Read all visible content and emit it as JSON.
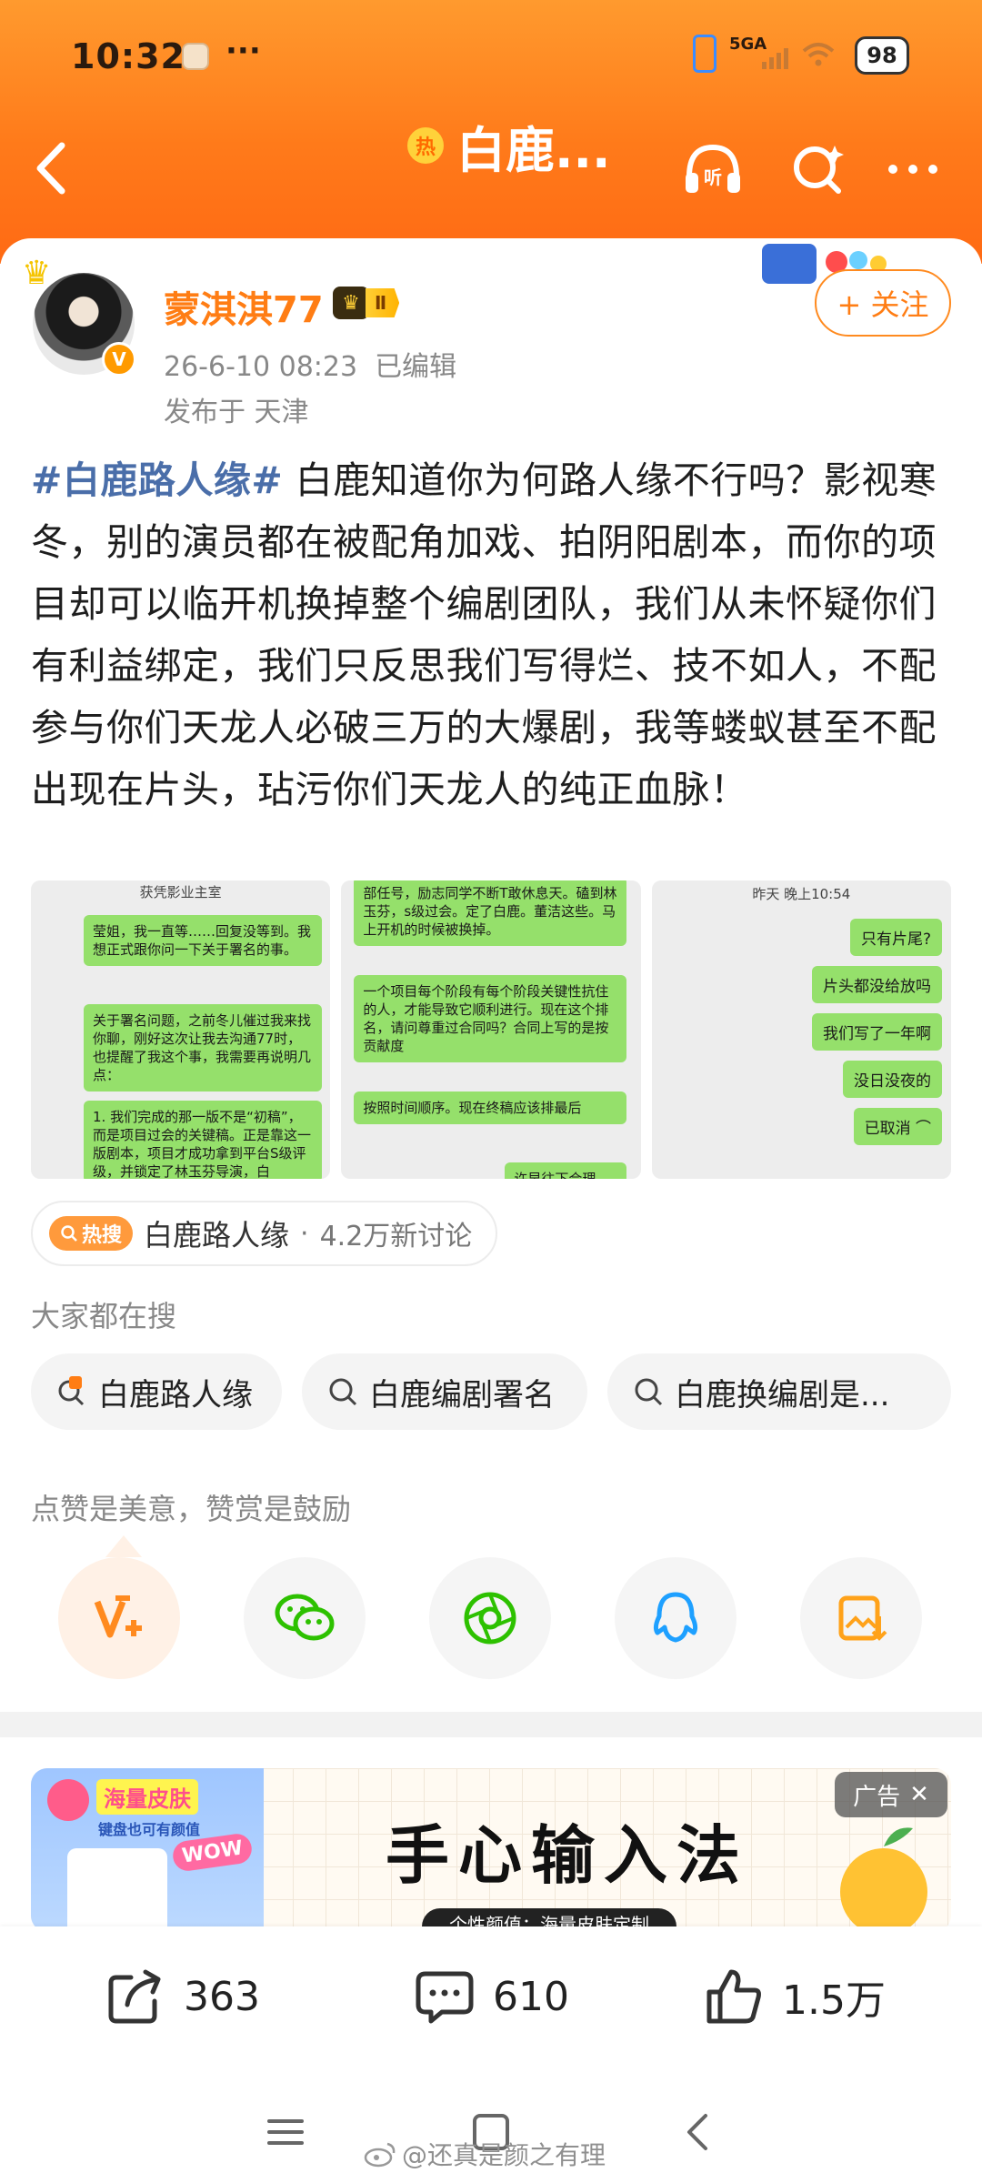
{
  "status_bar": {
    "time": "10:32",
    "dots": "···",
    "network": "5GA",
    "battery": "98"
  },
  "nav": {
    "title": "白鹿...",
    "hot_badge": "热"
  },
  "post": {
    "author": "蒙淇淇77",
    "level": "Ⅱ",
    "time": "26-6-10 08:23",
    "edited": "已编辑",
    "location": "发布于 天津",
    "follow_label": "+ 关注",
    "hashtag": "#白鹿路人缘#",
    "text": " 白鹿知道你为何路人缘不行吗？影视寒冬，别的演员都在被配角加戏、拍阴阳剧本，而你的项目却可以临开机换掉整个编剧团队，我们从未怀疑你们有利益绑定，我们只反思我们写得烂、技不如人，不配参与你们天龙人必破三万的大爆剧，我等蝼蚁甚至不配出现在片头，玷污你们天龙人的纯正血脉！"
  },
  "screenshots": {
    "shot1": {
      "header": "获凭影业主室",
      "bubbles": [
        "莹姐，我一直等……回复没等到。我想正式跟你问一下关于署名的事。",
        "关于署名问题，之前冬儿催过我来找你聊，刚好这次让我去沟通77时，也提醒了我这个事，我需要再说明几点：",
        "1. 我们完成的那一版不是“初稿”，而是项目过会的关键稿。正是靠这一版剧本，项目才成功拿到平台S级评级，并锁定了林玉芬导演，白"
      ]
    },
    "shot2": {
      "bubbles": [
        "部任号，励志同学不断T敢休息天。磕到林玉芬，s级过会。定了白鹿。董洁这些。马上开机的时候被换掉。",
        "一个项目每个阶段有每个阶段关键性抗住的人，才能导致它顺利进行。现在这个排名，请问尊重过合同吗？合同上写的是按贡献度",
        "按照时间顺序。现在终稿应该排最后",
        "许早往下合理"
      ]
    },
    "shot3": {
      "header": "昨天 晚上10:54",
      "bubbles": [
        "只有片尾?",
        "片头都没给放吗",
        "我们写了一年啊",
        "没日没夜的",
        "已取消 ⌒"
      ]
    }
  },
  "topic": {
    "hot_search_label": "热搜",
    "name": "白鹿路人缘",
    "separator": "·",
    "count": "4.2万新讨论"
  },
  "search_section": {
    "title": "大家都在搜",
    "chips": [
      "白鹿路人缘",
      "白鹿编剧署名",
      "白鹿换编剧是..."
    ]
  },
  "praise": {
    "tip": "点赞是美意，赞赏是鼓励"
  },
  "share_icons": [
    "weibo-v-plus-icon",
    "wechat-icon",
    "moments-icon",
    "qq-icon",
    "save-image-icon"
  ],
  "ad": {
    "tag": "广告",
    "left_title": "海量皮肤",
    "left_sub": "键盘也可有颜值",
    "wow": "WOW",
    "title": "手心输入法",
    "subtitle": "个性颜值：海量皮肤定制"
  },
  "actions": {
    "repost": "363",
    "comments": "610",
    "likes": "1.5万"
  },
  "watermark": "@还真是颜之有理",
  "colors": {
    "header_orange": "#ff7a1a",
    "username": "#ff7d14",
    "hashtag": "#4a6ea9",
    "bubble_green": "#95e06b"
  }
}
